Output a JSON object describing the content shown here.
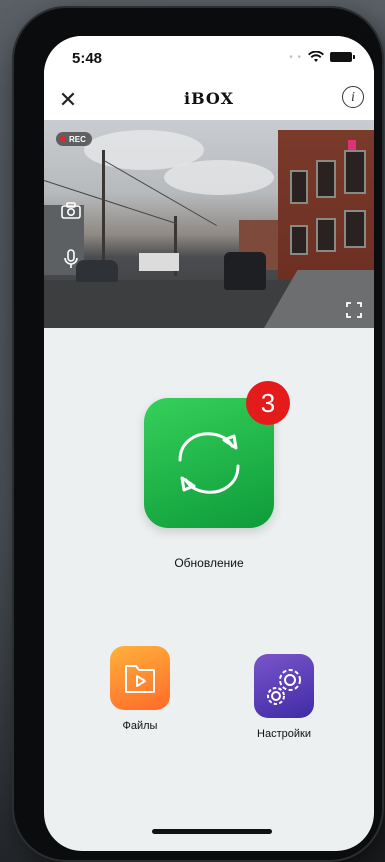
{
  "status_bar": {
    "time": "5:48"
  },
  "header": {
    "title": "iBOX",
    "close_symbol": "✕",
    "info_symbol": "i"
  },
  "video": {
    "rec_label": "REC"
  },
  "update": {
    "badge_count": "3",
    "label": "Обновление",
    "color": "#1fb34a"
  },
  "files": {
    "label": "Файлы",
    "color": "#ff8a2e"
  },
  "settings": {
    "label": "Настройки",
    "color": "#5a3fb8"
  },
  "icons": [
    "close-icon",
    "info-icon",
    "camera-icon",
    "microphone-icon",
    "fullscreen-icon",
    "refresh-icon",
    "folder-play-icon",
    "gears-icon",
    "wifi-icon",
    "battery-icon"
  ]
}
